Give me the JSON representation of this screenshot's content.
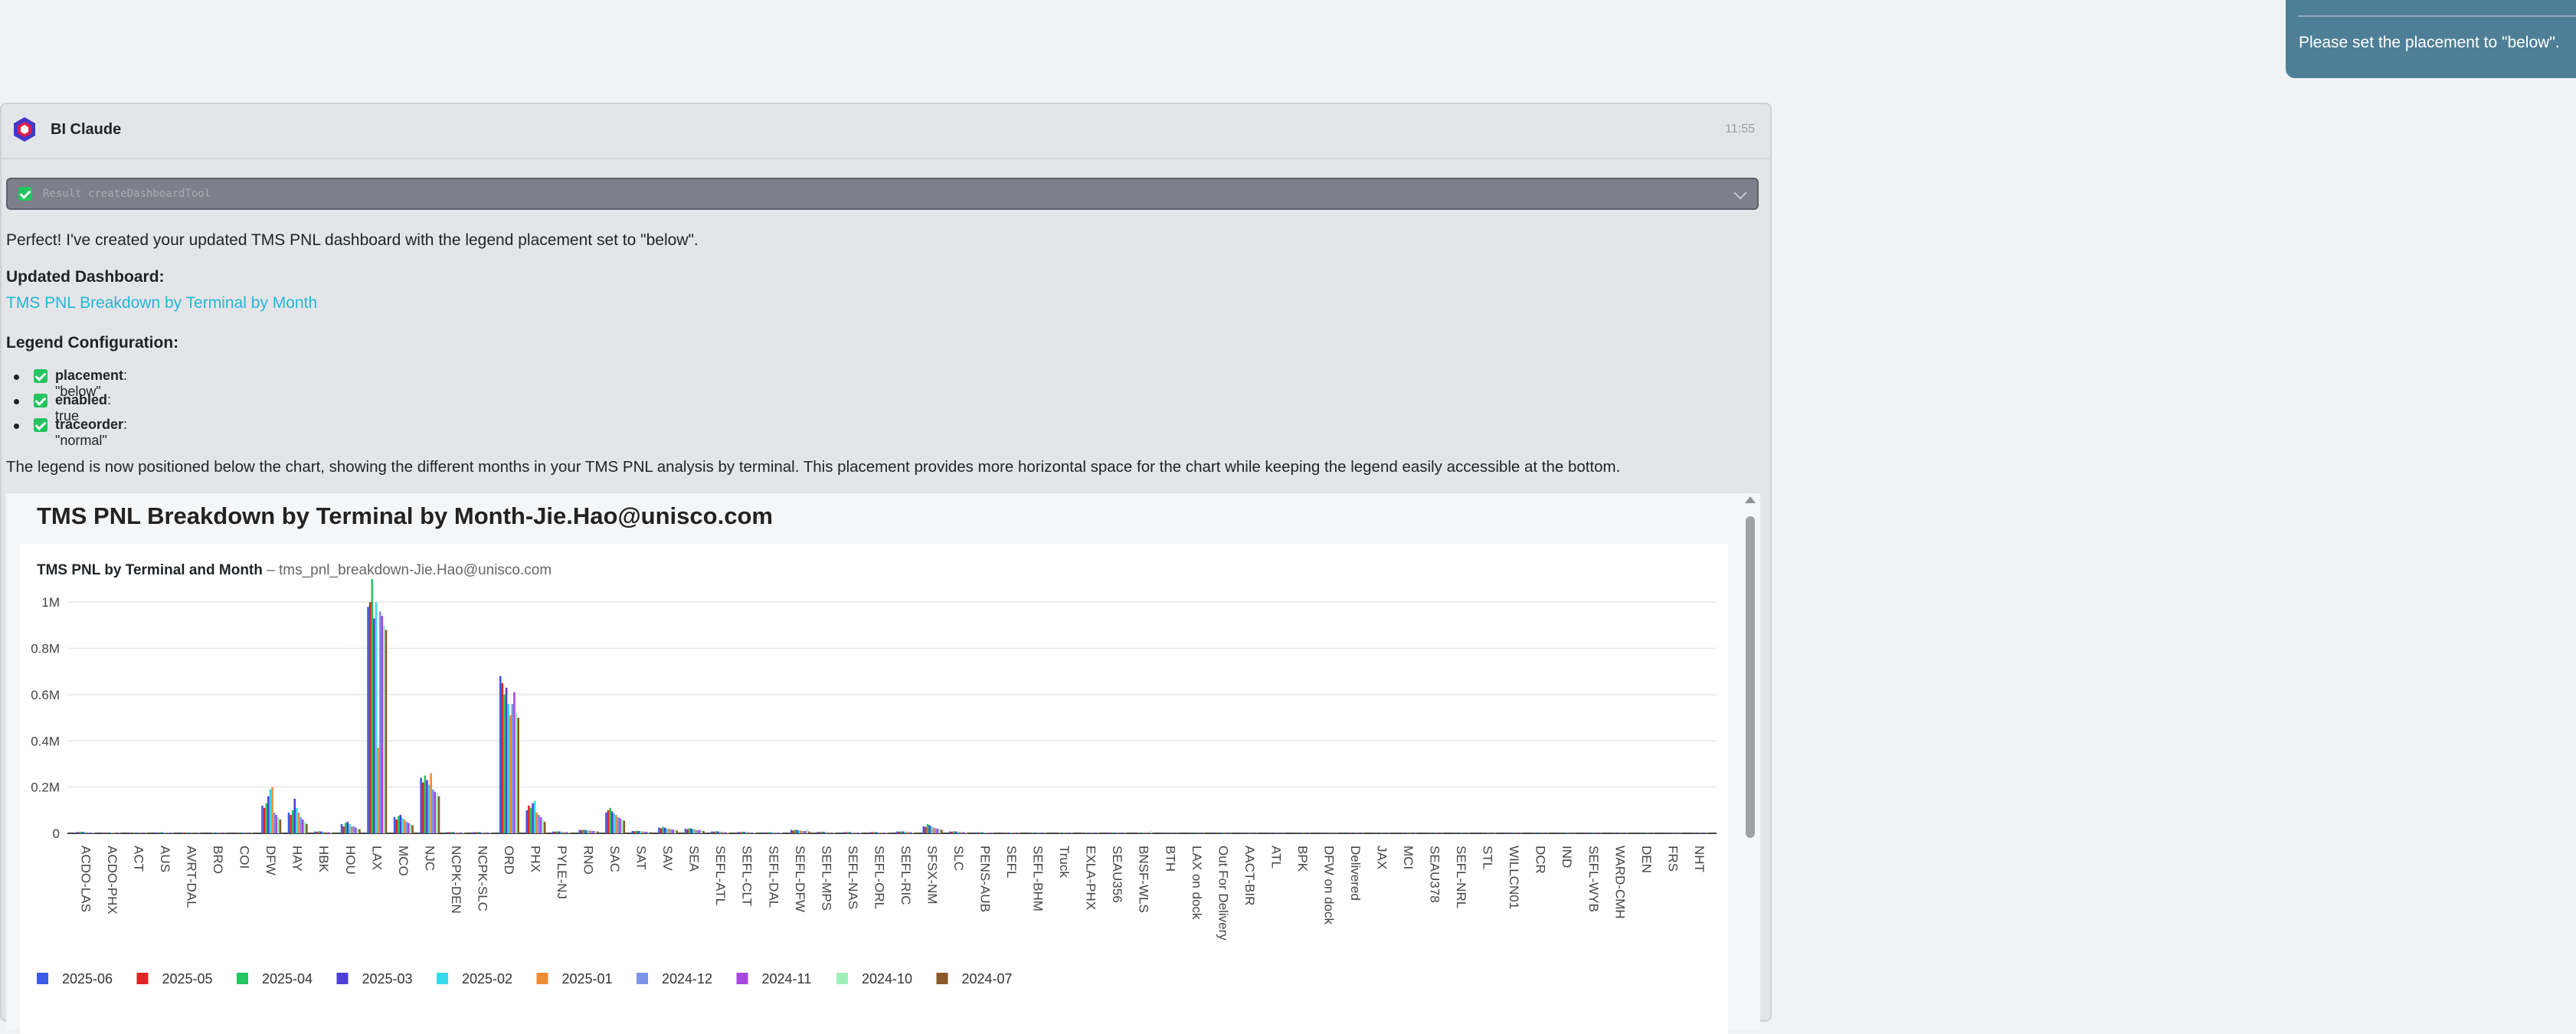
{
  "user_message": {
    "text": "Please set the placement to \"below\"."
  },
  "assistant": {
    "sender": "BI Claude",
    "time": "11:55",
    "tool_result": "Result createDashboardTool",
    "intro": "Perfect! I've created your updated TMS PNL dashboard with the legend placement set to \"below\".",
    "updated_heading": "Updated Dashboard:",
    "dashboard_link": "TMS PNL Breakdown by Terminal by Month",
    "legend_heading": "Legend Configuration:",
    "legend_items": [
      {
        "key": "placement",
        "value": ": \"below\""
      },
      {
        "key": "enabled",
        "value": ": true"
      },
      {
        "key": "traceorder",
        "value": ": \"normal\""
      }
    ],
    "summary": "The legend is now positioned below the chart, showing the different months in your TMS PNL analysis by terminal. This placement provides more horizontal space for the chart while keeping the legend easily accessible at the bottom."
  },
  "dashboard": {
    "title": "TMS PNL Breakdown by Terminal by Month-Jie.Hao@unisco.com",
    "chart_title": "TMS PNL by Terminal and Month",
    "chart_subtitle_sep": " – ",
    "chart_subtitle": "tms_pnl_breakdown-Jie.Hao@unisco.com"
  },
  "chart_data": {
    "type": "bar",
    "grid": true,
    "legend_placement": "below",
    "ylim": [
      0,
      1100000
    ],
    "yticks": [
      0,
      200000,
      400000,
      600000,
      800000,
      1000000
    ],
    "ytick_labels": [
      "0",
      "0.2M",
      "0.4M",
      "0.6M",
      "0.8M",
      "1M"
    ],
    "categories": [
      "ACDO-LAS",
      "ACDO-PHX",
      "ACT",
      "AUS",
      "AVRT-DAL",
      "BRO",
      "COI",
      "DFW",
      "HAY",
      "HBK",
      "HOU",
      "LAX",
      "MCO",
      "NJC",
      "NCPK-DEN",
      "NCPK-SLC",
      "ORD",
      "PHX",
      "PYLE-NJ",
      "RNO",
      "SAC",
      "SAT",
      "SAV",
      "SEA",
      "SEFL-ATL",
      "SEFL-CLT",
      "SEFL-DAL",
      "SEFL-DFW",
      "SEFL-MPS",
      "SEFL-NAS",
      "SEFL-ORL",
      "SEFL-RIC",
      "SFSX-NM",
      "SLC",
      "PENS-AUB",
      "SEFL",
      "SEFL-BHM",
      "Truck",
      "EXLA-PHX",
      "SEAU356",
      "BNSF-WLS",
      "BTH",
      "LAX on dock",
      "Out For Delivery",
      "AACT-BIR",
      "ATL",
      "BPK",
      "DFW on dock",
      "Delivered",
      "JAX",
      "MCI",
      "SEAU378",
      "SEFL-NRL",
      "STL",
      "WILLCN01",
      "DCR",
      "IND",
      "SEFL-WYB",
      "WARD-CMH",
      "DEN",
      "FRS",
      "NHT"
    ],
    "series": [
      {
        "name": "2025-06",
        "color": "#3b5ce6",
        "values": [
          6000,
          3000,
          2000,
          4000,
          3000,
          2000,
          3000,
          120000,
          90000,
          8000,
          40000,
          980000,
          70000,
          240000,
          5000,
          5000,
          680000,
          100000,
          8000,
          15000,
          90000,
          10000,
          25000,
          20000,
          8000,
          6000,
          4000,
          15000,
          6000,
          5000,
          5000,
          8000,
          30000,
          8000,
          4000,
          3000,
          2000,
          2000,
          2000,
          3000,
          2000,
          1000,
          1000,
          1000,
          1000,
          1000,
          1000,
          1000,
          1000,
          1000,
          1000,
          1000,
          1000,
          1000,
          1000,
          1000,
          1000,
          1000,
          1000,
          1000,
          1000,
          1000
        ]
      },
      {
        "name": "2025-05",
        "color": "#e02424",
        "values": [
          5000,
          3000,
          2000,
          3000,
          3000,
          2000,
          3000,
          110000,
          80000,
          7000,
          30000,
          1000000,
          60000,
          220000,
          5000,
          5000,
          650000,
          120000,
          7000,
          14000,
          100000,
          9000,
          22000,
          18000,
          7000,
          5000,
          4000,
          12000,
          6000,
          5000,
          5000,
          7000,
          28000,
          7000,
          4000,
          3000,
          2000,
          2000,
          2000,
          3000,
          2000,
          1000,
          1000,
          1000,
          1000,
          1000,
          1000,
          1000,
          1000,
          1000,
          1000,
          1000,
          1000,
          1000,
          1000,
          1000,
          1000,
          1000,
          1000,
          1000,
          1000,
          1000
        ]
      },
      {
        "name": "2025-04",
        "color": "#22c55e",
        "values": [
          7000,
          4000,
          3000,
          5000,
          4000,
          3000,
          4000,
          130000,
          100000,
          9000,
          45000,
          1100000,
          75000,
          250000,
          6000,
          6000,
          600000,
          110000,
          9000,
          16000,
          110000,
          11000,
          28000,
          22000,
          9000,
          7000,
          5000,
          16000,
          7000,
          6000,
          6000,
          9000,
          40000,
          9000,
          5000,
          4000,
          3000,
          3000,
          3000,
          4000,
          3000,
          1000,
          1000,
          1000,
          1000,
          1000,
          1000,
          1000,
          1000,
          1000,
          1000,
          1000,
          1000,
          1000,
          1000,
          1000,
          1000,
          1000,
          1000,
          1000,
          1000,
          1000
        ]
      },
      {
        "name": "2025-03",
        "color": "#4f3fd6",
        "values": [
          6000,
          3000,
          2000,
          4000,
          3000,
          2000,
          3000,
          160000,
          150000,
          8000,
          50000,
          930000,
          80000,
          230000,
          5000,
          5000,
          630000,
          130000,
          8000,
          14000,
          95000,
          10000,
          24000,
          20000,
          8000,
          6000,
          4000,
          14000,
          6000,
          5000,
          5000,
          8000,
          35000,
          8000,
          4000,
          3000,
          2000,
          2000,
          2000,
          3000,
          2000,
          1000,
          1000,
          1000,
          1000,
          1000,
          1000,
          1000,
          1000,
          1000,
          1000,
          1000,
          1000,
          1000,
          1000,
          1000,
          1000,
          1000,
          1000,
          1000,
          1000,
          1000
        ]
      },
      {
        "name": "2025-02",
        "color": "#38d9e8",
        "values": [
          5000,
          3000,
          2000,
          3000,
          2000,
          2000,
          2000,
          190000,
          110000,
          7000,
          40000,
          1000000,
          65000,
          210000,
          4000,
          4000,
          560000,
          140000,
          7000,
          12000,
          85000,
          9000,
          20000,
          18000,
          7000,
          5000,
          4000,
          13000,
          5000,
          4000,
          4000,
          7000,
          30000,
          7000,
          3000,
          3000,
          2000,
          2000,
          2000,
          2000,
          2000,
          1000,
          1000,
          1000,
          1000,
          1000,
          1000,
          1000,
          1000,
          1000,
          1000,
          1000,
          1000,
          1000,
          1000,
          1000,
          1000,
          1000,
          1000,
          1000,
          1000,
          1000
        ]
      },
      {
        "name": "2025-01",
        "color": "#f08a34",
        "values": [
          5000,
          3000,
          2000,
          3000,
          2000,
          2000,
          2000,
          200000,
          90000,
          6000,
          30000,
          370000,
          60000,
          260000,
          4000,
          4000,
          510000,
          90000,
          6000,
          12000,
          80000,
          8000,
          20000,
          16000,
          6000,
          5000,
          3000,
          12000,
          5000,
          4000,
          4000,
          6000,
          25000,
          6000,
          3000,
          3000,
          2000,
          2000,
          2000,
          2000,
          2000,
          1000,
          1000,
          1000,
          1000,
          1000,
          1000,
          1000,
          1000,
          1000,
          1000,
          1000,
          1000,
          1000,
          1000,
          1000,
          1000,
          1000,
          1000,
          1000,
          1000,
          1000
        ]
      },
      {
        "name": "2024-12",
        "color": "#7b93ea",
        "values": [
          4000,
          2000,
          2000,
          3000,
          2000,
          2000,
          2000,
          90000,
          70000,
          5000,
          30000,
          960000,
          50000,
          190000,
          4000,
          4000,
          560000,
          80000,
          5000,
          10000,
          70000,
          7000,
          18000,
          14000,
          5000,
          4000,
          3000,
          10000,
          4000,
          3000,
          3000,
          5000,
          22000,
          5000,
          3000,
          2000,
          2000,
          2000,
          2000,
          2000,
          2000,
          1000,
          1000,
          1000,
          1000,
          1000,
          1000,
          1000,
          1000,
          1000,
          1000,
          1000,
          1000,
          1000,
          1000,
          1000,
          1000,
          1000,
          1000,
          1000,
          1000,
          1000
        ]
      },
      {
        "name": "2024-11",
        "color": "#a647e0",
        "values": [
          4000,
          2000,
          2000,
          3000,
          2000,
          2000,
          2000,
          80000,
          60000,
          5000,
          25000,
          940000,
          45000,
          180000,
          4000,
          4000,
          610000,
          70000,
          5000,
          10000,
          65000,
          7000,
          16000,
          14000,
          5000,
          4000,
          3000,
          10000,
          4000,
          3000,
          3000,
          5000,
          20000,
          5000,
          3000,
          2000,
          2000,
          2000,
          2000,
          2000,
          2000,
          1000,
          1000,
          1000,
          1000,
          1000,
          1000,
          1000,
          1000,
          1000,
          1000,
          1000,
          1000,
          1000,
          1000,
          1000,
          1000,
          1000,
          1000,
          1000,
          1000,
          1000
        ]
      },
      {
        "name": "2024-10",
        "color": "#9ff0b8",
        "values": [
          3000,
          2000,
          2000,
          2000,
          2000,
          2000,
          2000,
          70000,
          50000,
          4000,
          20000,
          900000,
          40000,
          170000,
          3000,
          3000,
          520000,
          60000,
          4000,
          8000,
          60000,
          6000,
          14000,
          12000,
          4000,
          3000,
          3000,
          18000,
          3000,
          3000,
          3000,
          4000,
          18000,
          4000,
          2000,
          2000,
          2000,
          2000,
          2000,
          2000,
          9000,
          1000,
          1000,
          1000,
          1000,
          1000,
          1000,
          1000,
          1000,
          1000,
          1000,
          1000,
          1000,
          1000,
          1000,
          1000,
          1000,
          1000,
          1000,
          1000,
          1000,
          1000
        ]
      },
      {
        "name": "2024-07",
        "color": "#8a5a2b",
        "values": [
          3000,
          2000,
          2000,
          2000,
          2000,
          2000,
          2000,
          60000,
          40000,
          4000,
          18000,
          880000,
          35000,
          160000,
          3000,
          3000,
          500000,
          50000,
          4000,
          8000,
          55000,
          5000,
          12000,
          10000,
          4000,
          3000,
          3000,
          8000,
          3000,
          3000,
          3000,
          4000,
          16000,
          4000,
          2000,
          2000,
          2000,
          2000,
          2000,
          2000,
          2000,
          1000,
          1000,
          1000,
          1000,
          1000,
          1000,
          1000,
          1000,
          1000,
          1000,
          1000,
          1000,
          1000,
          1000,
          1000,
          1000,
          1000,
          1000,
          1000,
          1000,
          1000
        ]
      }
    ]
  }
}
